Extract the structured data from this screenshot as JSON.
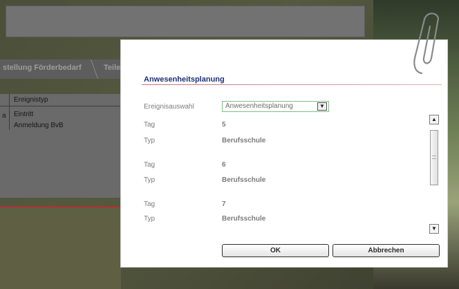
{
  "background": {
    "tabs": [
      "stellung Förderbedarf",
      "Teile"
    ],
    "table": {
      "header": "Ereignistyp",
      "left_fragment": "a",
      "rows": [
        "Eintritt",
        "Anmeldung BvB"
      ]
    }
  },
  "dialog": {
    "title": "Anwesenheitsplanung",
    "event_label": "Ereignisauswahl",
    "event_value": "Anwesenheitsplanung",
    "entries": [
      {
        "tag_label": "Tag",
        "tag_value": "5",
        "typ_label": "Typ",
        "typ_value": "Berufsschule"
      },
      {
        "tag_label": "Tag",
        "tag_value": "6",
        "typ_label": "Typ",
        "typ_value": "Berufsschule"
      },
      {
        "tag_label": "Tag",
        "tag_value": "7",
        "typ_label": "Typ",
        "typ_value": "Berufsschule"
      }
    ],
    "ok_label": "OK",
    "cancel_label": "Abbrechen"
  },
  "icons": {
    "select_arrow": "chevron-down-icon",
    "scroll_up": "arrow-up-icon",
    "scroll_down": "arrow-down-icon",
    "decoration": "paperclip-icon"
  },
  "colors": {
    "title": "#203078",
    "title_rule": "#c07070",
    "select_border": "#7fbf7f",
    "background_red_line": "#b03030"
  }
}
